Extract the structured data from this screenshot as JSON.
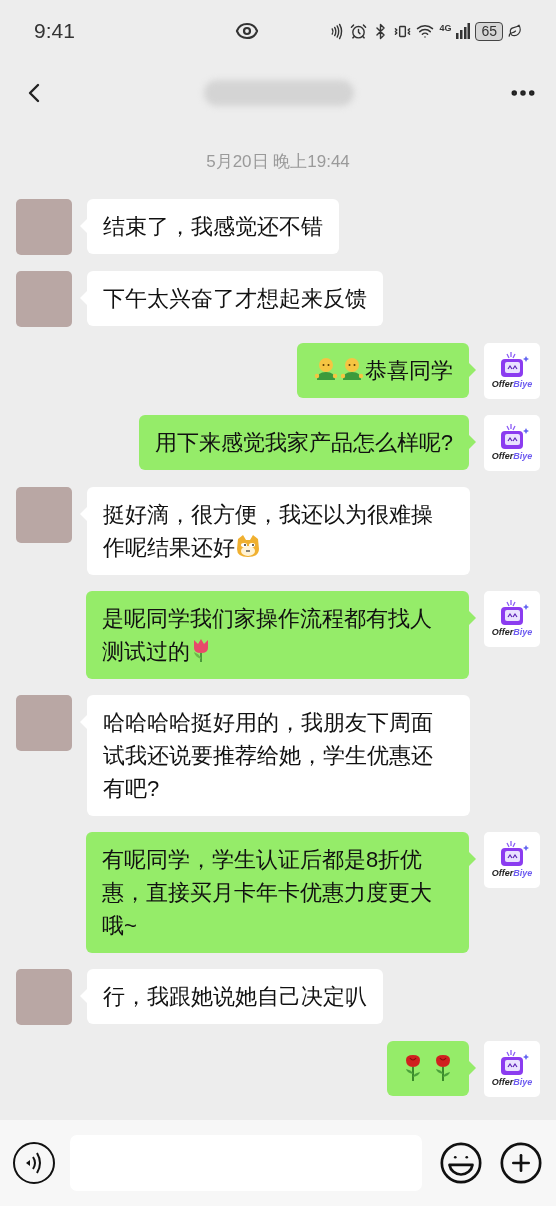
{
  "status_bar": {
    "time": "9:41",
    "network": "4G",
    "battery": "65"
  },
  "timestamp": "5月20日 晚上19:44",
  "messages": [
    {
      "kind": "received",
      "parts": [
        {
          "kind": "text",
          "text": "结束了，我感觉还不错"
        }
      ]
    },
    {
      "kind": "received",
      "parts": [
        {
          "kind": "text",
          "text": "下午太兴奋了才想起来反馈"
        }
      ]
    },
    {
      "kind": "sent",
      "parts": [
        {
          "kind": "hug"
        },
        {
          "kind": "hug"
        },
        {
          "kind": "text",
          "text": "恭喜同学"
        }
      ],
      "avatar": {
        "logo_dark": "Offer",
        "logo_accent": "Biye"
      }
    },
    {
      "kind": "sent",
      "parts": [
        {
          "kind": "text",
          "text": "用下来感觉我家产品怎么样呢?"
        }
      ],
      "avatar": {
        "logo_dark": "Offer",
        "logo_accent": "Biye"
      }
    },
    {
      "kind": "received",
      "parts": [
        {
          "kind": "text",
          "text": "挺好滴，很方便，我还以为很难操作呢结果还好"
        },
        {
          "kind": "doge"
        }
      ]
    },
    {
      "kind": "sent",
      "parts": [
        {
          "kind": "text",
          "text": "是呢同学我们家操作流程都有找人测试过的"
        },
        {
          "kind": "tulip"
        }
      ],
      "avatar": {
        "logo_dark": "Offer",
        "logo_accent": "Biye"
      }
    },
    {
      "kind": "received",
      "parts": [
        {
          "kind": "text",
          "text": "哈哈哈哈挺好用的，我朋友下周面试我还说要推荐给她，学生优惠还有吧?"
        }
      ]
    },
    {
      "kind": "sent",
      "parts": [
        {
          "kind": "text",
          "text": "有呢同学，学生认证后都是8折优惠，直接买月卡年卡优惠力度更大哦~"
        }
      ],
      "avatar": {
        "logo_dark": "Offer",
        "logo_accent": "Biye"
      }
    },
    {
      "kind": "received",
      "parts": [
        {
          "kind": "text",
          "text": "行，我跟她说她自己决定叭"
        }
      ]
    },
    {
      "kind": "sent",
      "parts": [
        {
          "kind": "rose"
        },
        {
          "kind": "space"
        },
        {
          "kind": "rose"
        }
      ],
      "avatar": {
        "logo_dark": "Offer",
        "logo_accent": "Biye"
      }
    }
  ]
}
